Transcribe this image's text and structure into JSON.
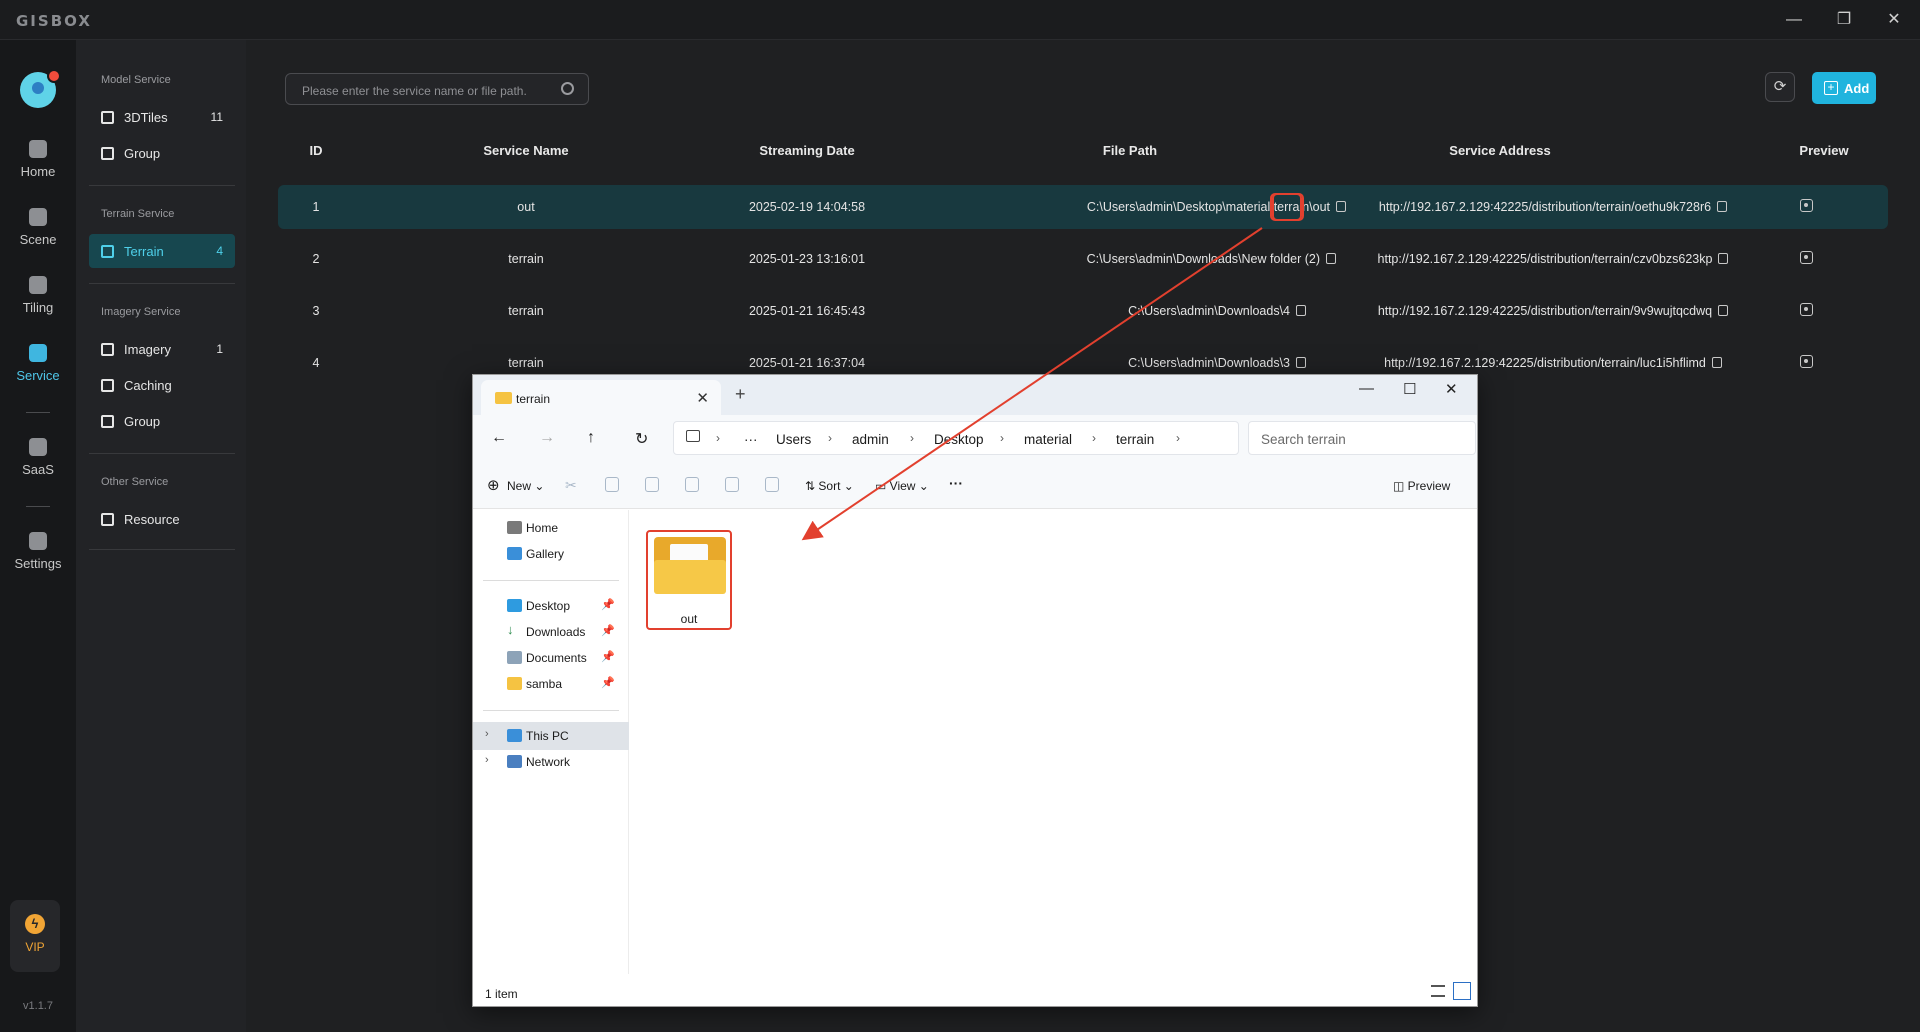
{
  "app": {
    "logo": "GISBOX",
    "version": "v1.1.7"
  },
  "window_controls": {
    "minimize": "—",
    "restore": "❐",
    "close": "✕"
  },
  "rail": {
    "items": [
      {
        "label": "Home",
        "icon": "home-icon"
      },
      {
        "label": "Scene",
        "icon": "scene-icon"
      },
      {
        "label": "Tiling",
        "icon": "tiling-icon"
      },
      {
        "label": "Service",
        "icon": "service-icon",
        "active": true
      },
      {
        "label": "SaaS",
        "icon": "saas-icon"
      },
      {
        "label": "Settings",
        "icon": "settings-icon"
      }
    ],
    "vip_label": "VIP"
  },
  "subnav": {
    "model_title": "Model Service",
    "model_items": [
      {
        "label": "3DTiles",
        "count": "11"
      },
      {
        "label": "Group",
        "count": ""
      }
    ],
    "terrain_title": "Terrain Service",
    "terrain_items": [
      {
        "label": "Terrain",
        "count": "4"
      }
    ],
    "imagery_title": "Imagery Service",
    "imagery_items": [
      {
        "label": "Imagery",
        "count": "1"
      },
      {
        "label": "Caching",
        "count": ""
      },
      {
        "label": "Group",
        "count": ""
      }
    ],
    "other_title": "Other Service",
    "other_items": [
      {
        "label": "Resource",
        "count": ""
      }
    ]
  },
  "toolbar": {
    "search_placeholder": "Please enter the service name or file path.",
    "add_label": "Add",
    "add_icon": "plus-square-icon",
    "refresh_icon": "refresh-icon"
  },
  "table": {
    "headers": {
      "id": "ID",
      "name": "Service Name",
      "date": "Streaming Date",
      "path": "File Path",
      "address": "Service Address",
      "preview": "Preview"
    },
    "rows": [
      {
        "id": "1",
        "name": "out",
        "date": "2025-02-19 14:04:58",
        "path": "C:\\Users\\admin\\Desktop\\material\\terrain\\out",
        "address": "http://192.167.2.129:42225/distribution/terrain/oethu9k728r6"
      },
      {
        "id": "2",
        "name": "terrain",
        "date": "2025-01-23 13:16:01",
        "path": "C:\\Users\\admin\\Downloads\\New folder (2)",
        "address": "http://192.167.2.129:42225/distribution/terrain/czv0bzs623kp"
      },
      {
        "id": "3",
        "name": "terrain",
        "date": "2025-01-21 16:45:43",
        "path": "C:\\Users\\admin\\Downloads\\4",
        "address": "http://192.167.2.129:42225/distribution/terrain/9v9wujtqcdwq"
      },
      {
        "id": "4",
        "name": "terrain",
        "date": "2025-01-21 16:37:04",
        "path": "C:\\Users\\admin\\Downloads\\3",
        "address": "http://192.167.2.129:42225/distribution/terrain/luc1i5hflimd"
      }
    ]
  },
  "explorer": {
    "tab_title": "terrain",
    "tab_close": "✕",
    "new_tab": "+",
    "controls": {
      "minimize": "—",
      "maximize": "☐",
      "close": "✕"
    },
    "breadcrumb": [
      "Users",
      "admin",
      "Desktop",
      "material",
      "terrain"
    ],
    "breadcrumb_more": "···",
    "search_placeholder": "Search terrain",
    "toolbar": {
      "new": "New",
      "sort": "Sort",
      "view": "View",
      "more": "···",
      "preview": "Preview"
    },
    "nav": {
      "quick": [
        {
          "label": "Home"
        },
        {
          "label": "Gallery"
        }
      ],
      "pinned": [
        {
          "label": "Desktop"
        },
        {
          "label": "Downloads"
        },
        {
          "label": "Documents"
        },
        {
          "label": "samba"
        }
      ],
      "locations": [
        {
          "label": "This PC"
        },
        {
          "label": "Network"
        }
      ]
    },
    "items": [
      {
        "name": "out",
        "type": "folder"
      }
    ],
    "status": "1 item"
  },
  "colors": {
    "accent": "#20b4de",
    "highlight": "#e2402e",
    "selected_row": "#18393f"
  }
}
